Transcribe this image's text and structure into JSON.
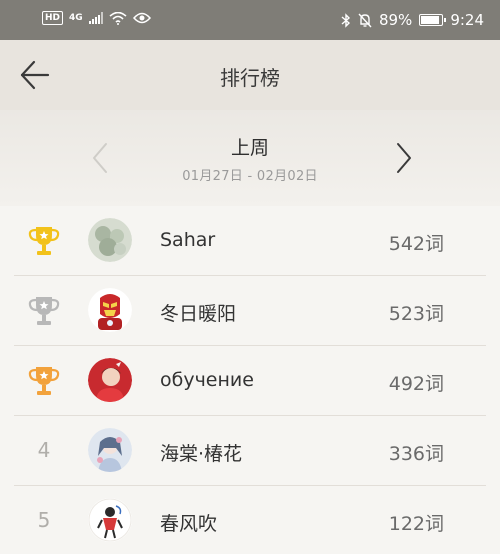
{
  "status_bar": {
    "hd": "HD",
    "network": "4G",
    "battery": "89%",
    "battery_level": 0.89,
    "time": "9:24",
    "icons": [
      "signal-icon",
      "wifi-icon",
      "eye-icon",
      "bluetooth-icon",
      "mute-bell-icon",
      "battery-icon"
    ]
  },
  "header": {
    "title": "排行榜",
    "back_icon": "back-arrow-icon"
  },
  "week": {
    "label": "上周",
    "range": "01月27日 - 02月02日",
    "prev_icon": "chevron-left-icon",
    "next_icon": "chevron-right-icon"
  },
  "colors": {
    "gold": "#f2c21a",
    "silver": "#b8b8b8",
    "bronze": "#f2a23c",
    "status_bar": "#7f7d77",
    "app_bar": "#e8e4de"
  },
  "rankings": [
    {
      "rank": "1",
      "medal": "gold-trophy-icon",
      "name": "Sahar",
      "words": "542词"
    },
    {
      "rank": "2",
      "medal": "silver-trophy-icon",
      "name": "冬日暖阳",
      "words": "523词"
    },
    {
      "rank": "3",
      "medal": "bronze-trophy-icon",
      "name": "обучение",
      "words": "492词"
    },
    {
      "rank": "4",
      "name": "海棠·椿花",
      "words": "336词"
    },
    {
      "rank": "5",
      "name": "春风吹",
      "words": "122词"
    }
  ]
}
